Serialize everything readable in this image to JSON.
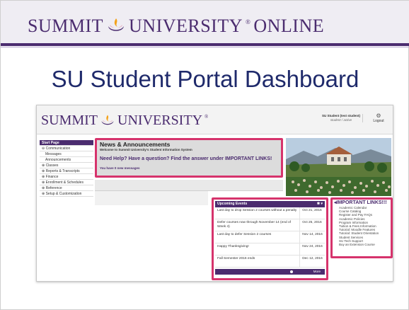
{
  "slide": {
    "brand_summit": "SUMMIT",
    "brand_university": "UNIVERSITY",
    "brand_online": "ONLINE",
    "title": "SU Student Portal Dashboard",
    "accent_color": "#4b2c6f",
    "highlight_color": "#d6336c"
  },
  "portal": {
    "brand_summit": "SUMMIT",
    "brand_university": "UNIVERSITY",
    "user_name": "SU Student (test student)",
    "user_status": "student / active",
    "logout_label": "Logout",
    "sidebar": [
      {
        "label": "Start Page",
        "active": true
      },
      {
        "label": "⊖ Communication"
      },
      {
        "label": "Messages",
        "sub": true
      },
      {
        "label": "Announcements",
        "sub": true
      },
      {
        "label": "⊕ Classes"
      },
      {
        "label": "⊕ Reports & Transcripts"
      },
      {
        "label": "⊕ Finance"
      },
      {
        "label": "⊕ Enrollment & Schedules"
      },
      {
        "label": "⊕ Reference"
      },
      {
        "label": "⊕ Setup & Customization"
      }
    ],
    "news": {
      "title": "News & Announcements",
      "welcome": "Welcome to Summit University's Student Information System",
      "help": "Need Help? Have a question? Find the answer under IMPORTANT LINKS!",
      "messages": "You have 0 new messages"
    },
    "events": {
      "title": "Upcoming Events",
      "controls": "✱ ▾",
      "more_label": "More",
      "rows": [
        {
          "text": "Last day to drop Session 2 courses without a penalty",
          "date": "Oct 21, 2016"
        },
        {
          "text": "Defer courses now through November 14 (end of Week 4)",
          "date": "Oct 25, 2016"
        },
        {
          "text": "Last day to defer Session 2 courses",
          "date": "Nov 14, 2016"
        },
        {
          "text": "Happy Thanksgiving!",
          "date": "Nov 24, 2016"
        },
        {
          "text": "Fall Semester 2016 ends",
          "date": "Dec 12, 2016"
        }
      ]
    },
    "links": {
      "title": "◂IMPORTANT LINKS!!!",
      "items": [
        "Academic Calendar",
        "Course Catalog",
        "Register and Pay FAQs",
        "Academic Policies",
        "Program Information",
        "Tuition & Fees Information",
        "Tutorial: Moodle Features",
        "Tutorial: Student Orientation",
        "Student Services",
        "SU Tech Support",
        "Buy an Extension Course"
      ]
    }
  }
}
